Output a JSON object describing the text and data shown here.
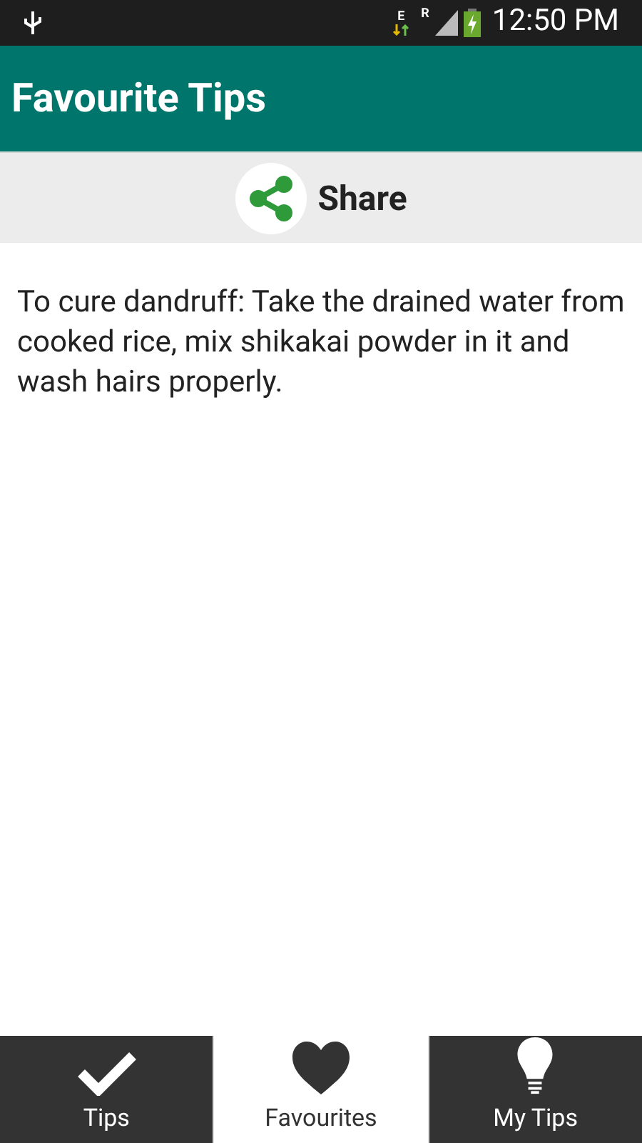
{
  "status_bar": {
    "data_letter": "E",
    "roaming_letter": "R",
    "time": "12:50 PM"
  },
  "app_bar": {
    "title": "Favourite Tips"
  },
  "share_bar": {
    "label": "Share"
  },
  "tip": {
    "text": "To cure dandruff: Take the drained water from cooked rice, mix shikakai powder in it and wash hairs properly."
  },
  "tabs": [
    {
      "kind": "check",
      "label": "Tips",
      "selected": false
    },
    {
      "kind": "heart",
      "label": "Favourites",
      "selected": true
    },
    {
      "kind": "bulb",
      "label": "My Tips",
      "selected": false
    }
  ]
}
